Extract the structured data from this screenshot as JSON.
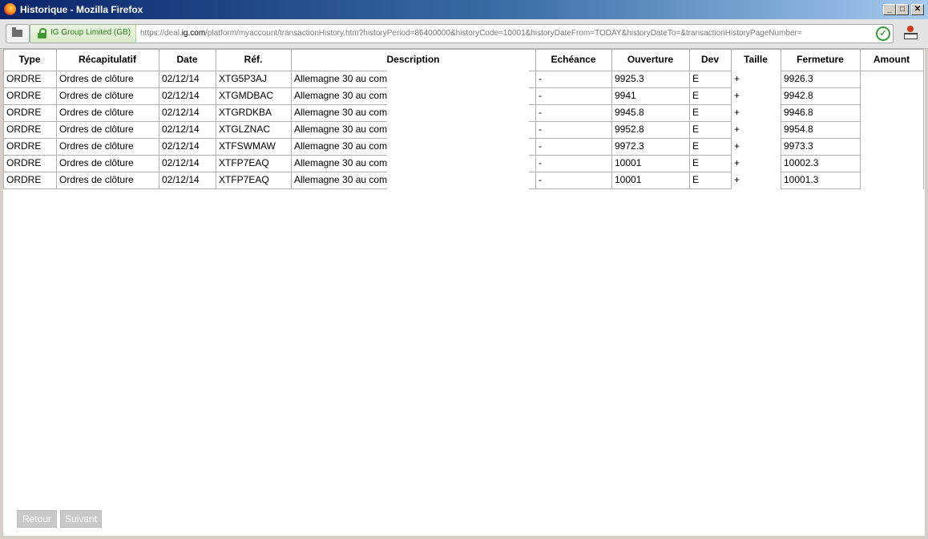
{
  "window": {
    "title": "Historique - Mozilla Firefox",
    "minimize_glyph": "_",
    "maximize_glyph": "□",
    "close_glyph": "✕"
  },
  "urlbar": {
    "identity_label": "IG Group Limited (GB)",
    "url_prefix": "https://deal.",
    "url_domain": "ig.com",
    "url_rest": "/platform/myaccount/transactionHistory.htm?historyPeriod=86400000&historyCode=10001&historyDateFrom=TODAY&historyDateTo=&transactionHistoryPageNumber=",
    "identity_color": "#2c7a1c",
    "check_glyph": "✓"
  },
  "table": {
    "columns": [
      "Type",
      "Récapitulatif",
      "Date",
      "Réf.",
      "Description",
      "Echéance",
      "Ouverture",
      "Dev",
      "Taille",
      "Fermeture",
      "Amount"
    ],
    "rows": [
      [
        "ORDRE",
        "Ordres de clôture",
        "02/12/14",
        "XTG5P3AJ",
        "Allemagne 30 au com",
        "-",
        "9925.3",
        "E",
        "+",
        "",
        "9926.3",
        ""
      ],
      [
        "ORDRE",
        "Ordres de clôture",
        "02/12/14",
        "XTGMDBAC",
        "Allemagne 30 au com",
        "-",
        "9941",
        "E",
        "+",
        "",
        "9942.8",
        ""
      ],
      [
        "ORDRE",
        "Ordres de clôture",
        "02/12/14",
        "XTGRDKBA",
        "Allemagne 30 au com",
        "-",
        "9945.8",
        "E",
        "+",
        "",
        "9946.8",
        ""
      ],
      [
        "ORDRE",
        "Ordres de clôture",
        "02/12/14",
        "XTGLZNAC",
        "Allemagne 30 au com",
        "-",
        "9952.8",
        "E",
        "+",
        "",
        "9954.8",
        ""
      ],
      [
        "ORDRE",
        "Ordres de clôture",
        "02/12/14",
        "XTFSWMAW",
        "Allemagne 30 au com",
        "-",
        "9972.3",
        "E",
        "+",
        "",
        "9973.3",
        ""
      ],
      [
        "ORDRE",
        "Ordres de clôture",
        "02/12/14",
        "XTFP7EAQ",
        "Allemagne 30 au com",
        "-",
        "10001",
        "E",
        "+",
        "",
        "10002.3",
        ""
      ],
      [
        "ORDRE",
        "Ordres de clôture",
        "02/12/14",
        "XTFP7EAQ",
        "Allemagne 30 au com",
        "-",
        "10001",
        "E",
        "+",
        "",
        "10001.3",
        ""
      ]
    ]
  },
  "pagination": {
    "back_label": "Retour",
    "next_label": "Suivant"
  }
}
